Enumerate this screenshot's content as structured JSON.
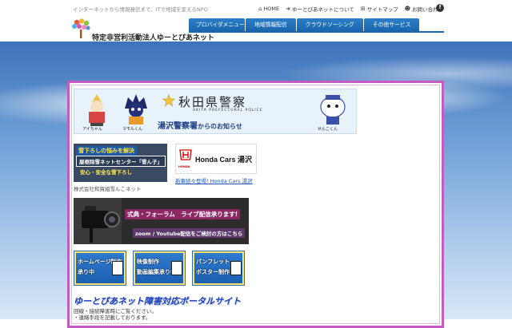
{
  "header": {
    "tagline": "インターネットから情報発信まで、ITで地域を変えるNPO",
    "org_name": "特定非営利活動法人ゆーとぴあネット",
    "top_links": [
      {
        "icon": "home-icon",
        "label": "HOME"
      },
      {
        "icon": "arrow-right-icon",
        "label": "ゆーとぴあネットについて"
      },
      {
        "icon": "sitemap-icon",
        "label": "サイトマップ"
      },
      {
        "icon": "user-icon",
        "label": "お問い合わせ"
      }
    ],
    "facebook": "f"
  },
  "nav": {
    "items": [
      "プロバイダメニュー",
      "地域情報配信",
      "クラウドソーシング",
      "その他サービス"
    ]
  },
  "police_banner": {
    "title": "秋田県警察",
    "subtitle": "AKITA PREFECTURAL POLICE",
    "notice_main": "湯沢警察署",
    "notice_rest": "からのお知らせ",
    "mascots": [
      "アイちゃん",
      "マモルくん",
      "せんこくん"
    ]
  },
  "snow_banner": {
    "line1": "雪下ろしの悩みを解決",
    "line2": "屋根除雪ネットセンター「雪ん子」",
    "line3": "安心・安全な雪下ろし",
    "caption": "株式会社和賀組雪んこネット"
  },
  "honda": {
    "brand_small": "HONDA",
    "name": "Honda Cars 湯沢",
    "link": "新車続々登場! Honda Cars 湯沢"
  },
  "live_banner": {
    "line1": "式典・フォーラム　ライブ配信承ります!",
    "line2": "zoom / Youtube配信をご検討の方はこちら"
  },
  "services": [
    {
      "line1": "ホームページ制作",
      "line2": "承り中"
    },
    {
      "line1": "映像制作",
      "line2": "動画編集承り中"
    },
    {
      "line1": "パンフレット",
      "line2": "ポスター制作"
    }
  ],
  "portal": {
    "title": "ゆーとぴあネット障害対応ポータルサイト",
    "lines": [
      "回線・接続障害時にご覧ください。",
      "・連絡手段を記載しております。"
    ]
  },
  "colors": {
    "nav": "#1b66ad",
    "frame": "#c45bc1",
    "portal": "#1e3fb4"
  }
}
